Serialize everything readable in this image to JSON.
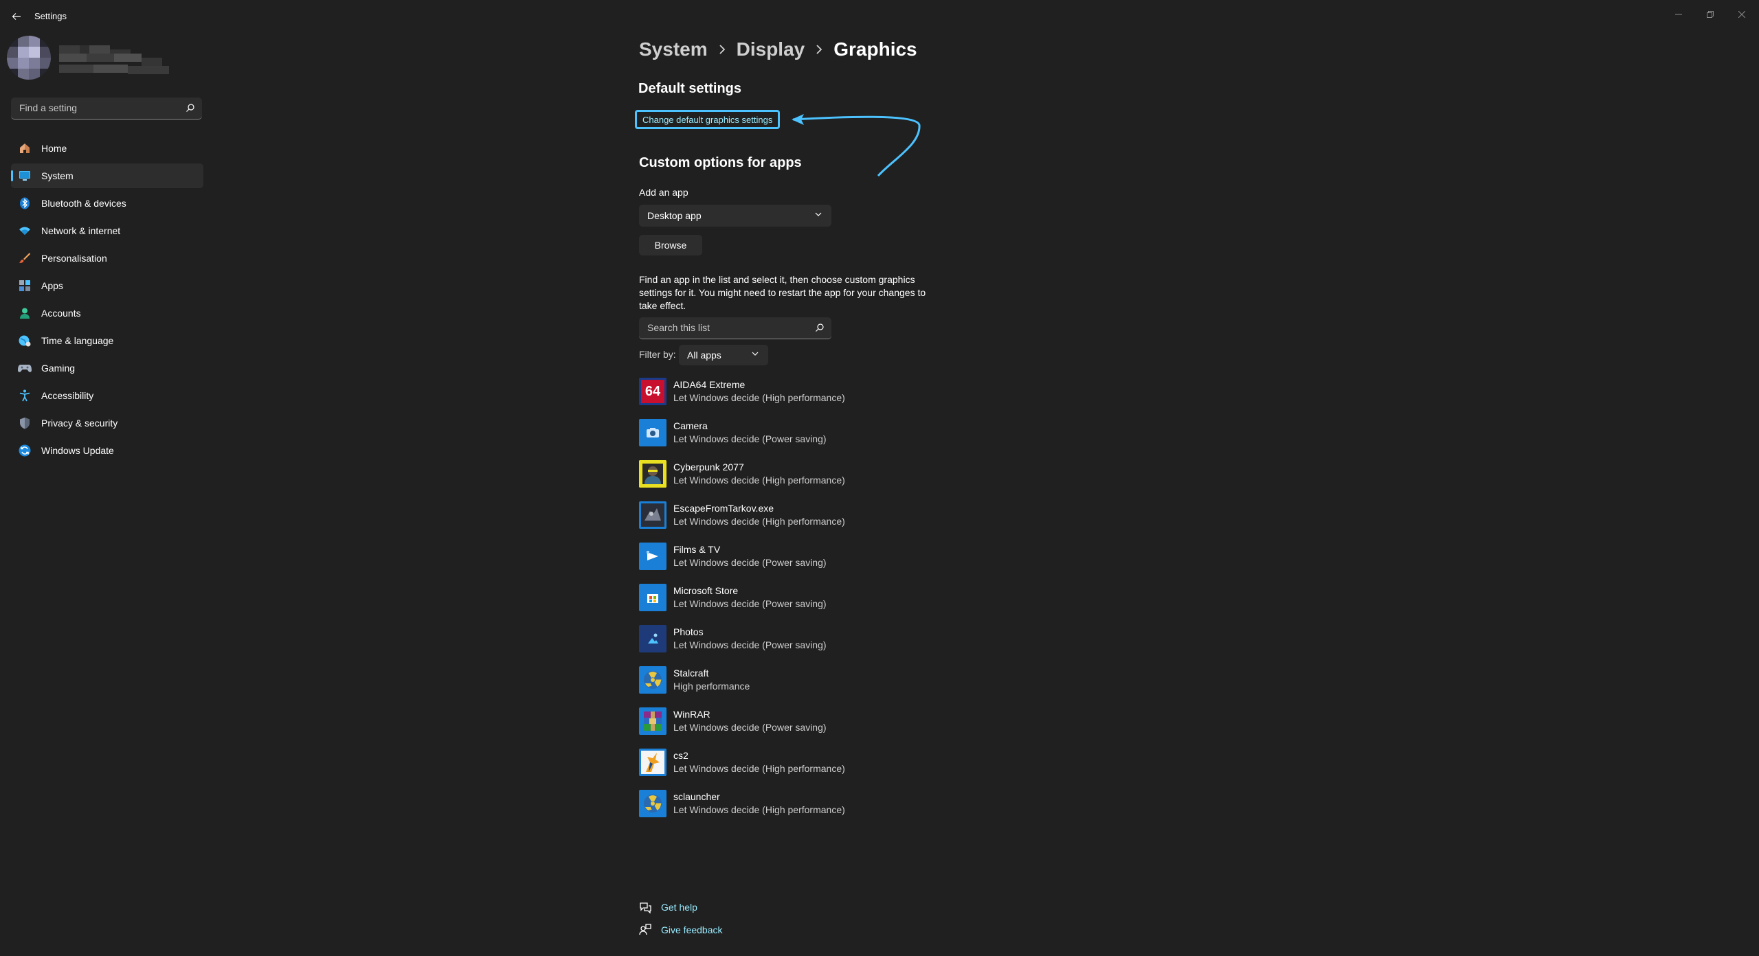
{
  "window": {
    "title": "Settings"
  },
  "search": {
    "placeholder": "Find a setting"
  },
  "nav": [
    {
      "label": "Home",
      "icon": "home-icon"
    },
    {
      "label": "System",
      "icon": "system-icon"
    },
    {
      "label": "Bluetooth & devices",
      "icon": "bluetooth-icon"
    },
    {
      "label": "Network & internet",
      "icon": "wifi-icon"
    },
    {
      "label": "Personalisation",
      "icon": "brush-icon"
    },
    {
      "label": "Apps",
      "icon": "apps-icon"
    },
    {
      "label": "Accounts",
      "icon": "person-icon"
    },
    {
      "label": "Time & language",
      "icon": "globe-icon"
    },
    {
      "label": "Gaming",
      "icon": "gamepad-icon"
    },
    {
      "label": "Accessibility",
      "icon": "accessibility-icon"
    },
    {
      "label": "Privacy & security",
      "icon": "shield-icon"
    },
    {
      "label": "Windows Update",
      "icon": "update-icon"
    }
  ],
  "breadcrumb": [
    "System",
    "Display",
    "Graphics"
  ],
  "default_settings": {
    "title": "Default settings",
    "link": "Change default graphics settings"
  },
  "custom": {
    "title": "Custom options for apps",
    "add_label": "Add an app",
    "app_type": "Desktop app",
    "browse": "Browse",
    "description": "Find an app in the list and select it, then choose custom graphics settings for it. You might need to restart the app for your changes to take effect.",
    "search_placeholder": "Search this list",
    "filter_label": "Filter by:",
    "filter_value": "All apps"
  },
  "apps": [
    {
      "name": "AIDA64 Extreme",
      "pref": "Let Windows decide (High performance)",
      "icon": "aida64-icon",
      "icon_text": "64"
    },
    {
      "name": "Camera",
      "pref": "Let Windows decide (Power saving)",
      "icon": "camera-icon"
    },
    {
      "name": "Cyberpunk 2077",
      "pref": "Let Windows decide (High performance)",
      "icon": "cyberpunk-icon"
    },
    {
      "name": "EscapeFromTarkov.exe",
      "pref": "Let Windows decide (High performance)",
      "icon": "tarkov-icon"
    },
    {
      "name": "Films & TV",
      "pref": "Let Windows decide (Power saving)",
      "icon": "films-tv-icon"
    },
    {
      "name": "Microsoft Store",
      "pref": "Let Windows decide (Power saving)",
      "icon": "store-icon"
    },
    {
      "name": "Photos",
      "pref": "Let Windows decide (Power saving)",
      "icon": "photos-icon"
    },
    {
      "name": "Stalcraft",
      "pref": "High performance",
      "icon": "stalcraft-icon"
    },
    {
      "name": "WinRAR",
      "pref": "Let Windows decide (Power saving)",
      "icon": "winrar-icon"
    },
    {
      "name": "cs2",
      "pref": "Let Windows decide (High performance)",
      "icon": "cs2-icon"
    },
    {
      "name": "sclauncher",
      "pref": "Let Windows decide (High performance)",
      "icon": "sclauncher-icon"
    }
  ],
  "help": {
    "get_help": "Get help",
    "feedback": "Give feedback"
  },
  "colors": {
    "background": "#202020",
    "accent": "#4cc2ff",
    "link": "#99ebff",
    "surface": "#2d2d2d"
  }
}
